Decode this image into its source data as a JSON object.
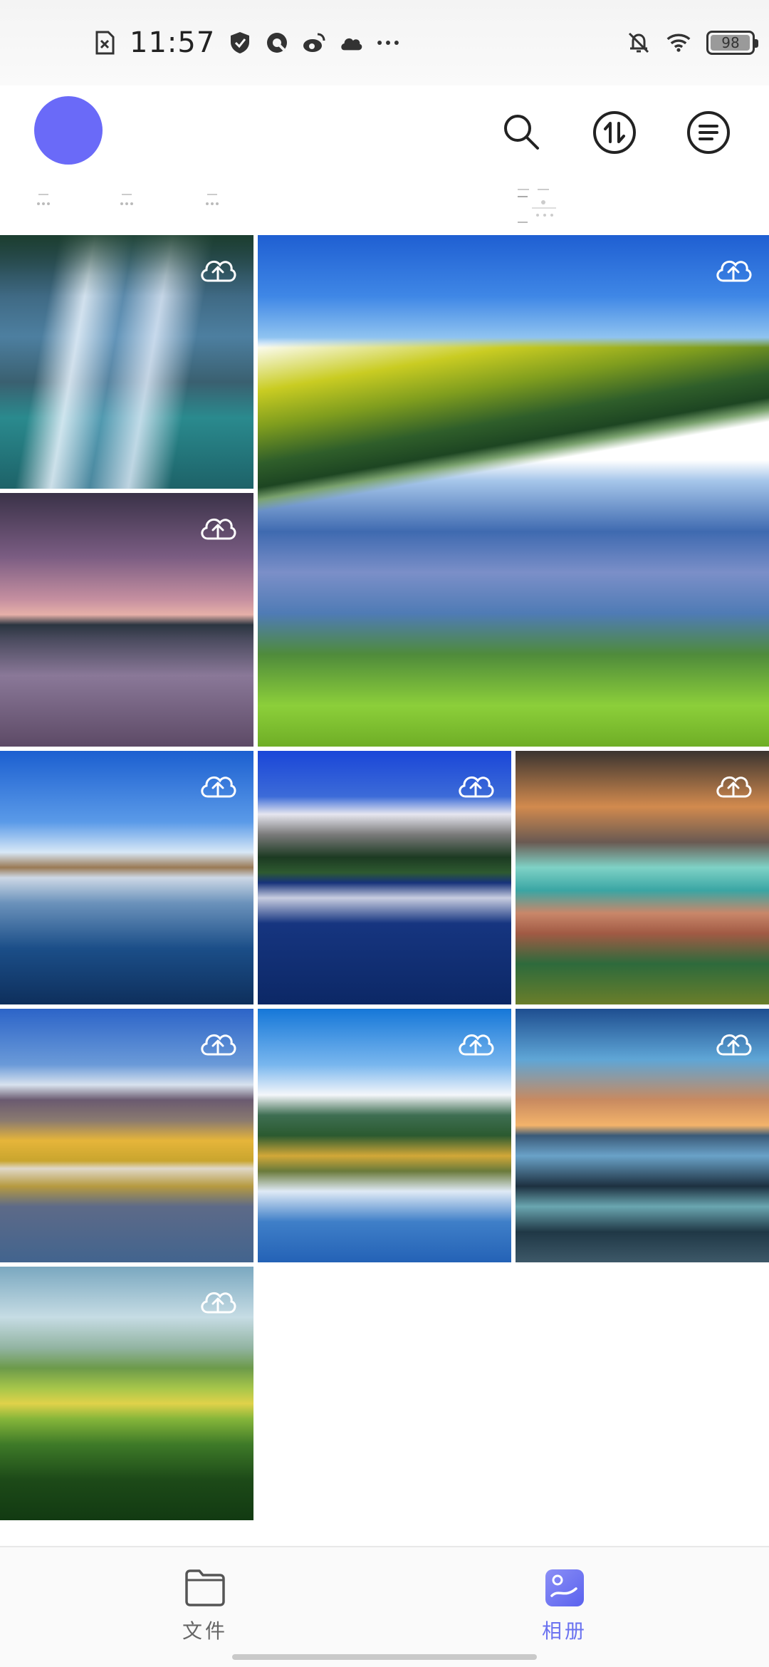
{
  "status_bar": {
    "time": "11:57",
    "battery": "98",
    "battery_level": 0.98,
    "left_icons": [
      "sim-card-icon",
      "shield-icon",
      "qq-icon",
      "weibo-icon",
      "cloud-icon",
      "more-dots-icon"
    ],
    "right_icons": [
      "mute-bell-icon",
      "wifi-icon",
      "battery-icon"
    ]
  },
  "header": {
    "avatar_color": "#6a6af8",
    "actions": [
      "search-icon",
      "transfer-icon",
      "menu-icon"
    ]
  },
  "photos": [
    {
      "name": "waterfall",
      "upload_icon": "cloud-upload-icon"
    },
    {
      "name": "lake-mountain-reflection",
      "upload_icon": "cloud-upload-icon"
    },
    {
      "name": "pink-dusk-lake",
      "upload_icon": "cloud-upload-icon"
    },
    {
      "name": "blue-lake",
      "upload_icon": "cloud-upload-icon"
    },
    {
      "name": "snowy-mountain-lake",
      "upload_icon": "cloud-upload-icon"
    },
    {
      "name": "volcano-sunset",
      "upload_icon": "cloud-upload-icon"
    },
    {
      "name": "autumn-trees-lake",
      "upload_icon": "cloud-upload-icon"
    },
    {
      "name": "mountain-lake-clouds",
      "upload_icon": "cloud-upload-icon"
    },
    {
      "name": "rocky-shore-sunset",
      "upload_icon": "cloud-upload-icon"
    },
    {
      "name": "green-valley",
      "upload_icon": "cloud-upload-icon"
    }
  ],
  "bottom_nav": {
    "items": [
      {
        "label": "文件",
        "icon": "folder-icon",
        "active": false
      },
      {
        "label": "相册",
        "icon": "album-icon",
        "active": true
      }
    ],
    "active_color": "#6b73f0"
  }
}
